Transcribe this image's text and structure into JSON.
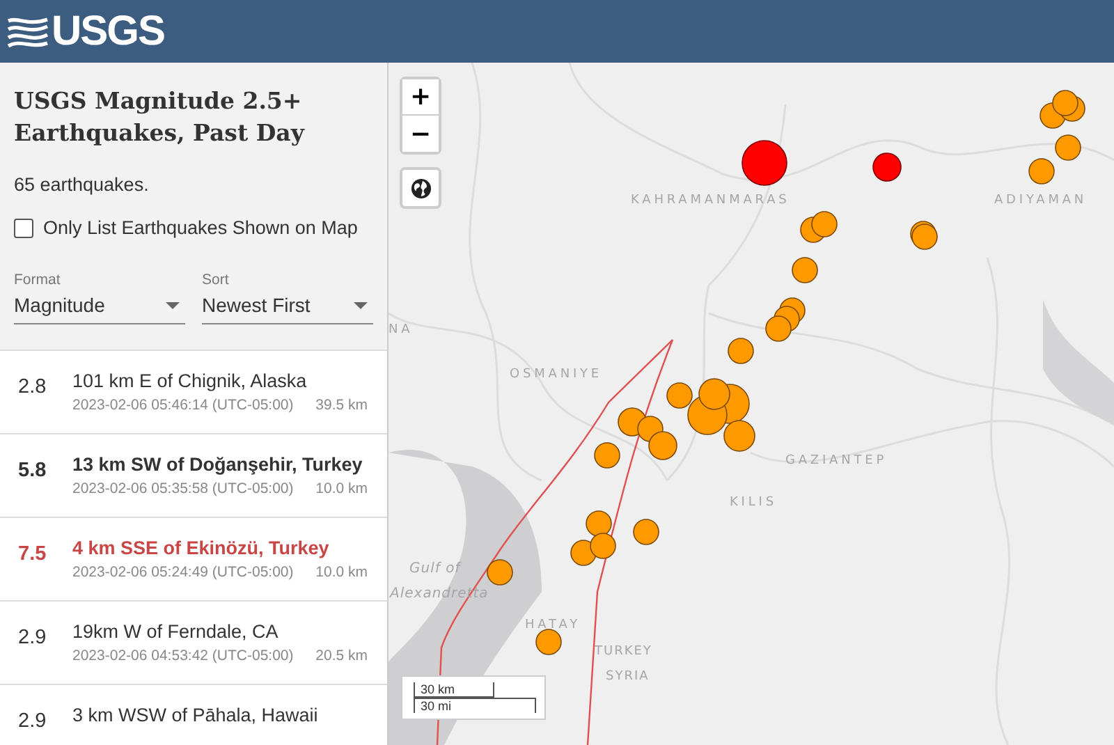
{
  "header": {
    "logo": "USGS"
  },
  "sidebar": {
    "title": "USGS Magnitude 2.5+ Earthquakes, Past Day",
    "count": "65 earthquakes.",
    "filter": {
      "label": "Only List Earthquakes Shown on Map",
      "checked": false
    },
    "selects": [
      {
        "label": "Format",
        "value": "Magnitude"
      },
      {
        "label": "Sort",
        "value": "Newest First"
      }
    ]
  },
  "earthquakes": [
    {
      "magnitude": "2.8",
      "place": "101 km E of Chignik, Alaska",
      "time": "2023-02-06 05:46:14 (UTC-05:00)",
      "depth": "39.5 km",
      "significant": false,
      "selected": false
    },
    {
      "magnitude": "5.8",
      "place": "13 km SW of Doğanşehir, Turkey",
      "time": "2023-02-06 05:35:58 (UTC-05:00)",
      "depth": "10.0 km",
      "significant": true,
      "selected": false
    },
    {
      "magnitude": "7.5",
      "place": "4 km SSE of Ekinözü, Turkey",
      "time": "2023-02-06 05:24:49 (UTC-05:00)",
      "depth": "10.0 km",
      "significant": true,
      "selected": true
    },
    {
      "magnitude": "2.9",
      "place": "19km W of Ferndale, CA",
      "time": "2023-02-06 04:53:42 (UTC-05:00)",
      "depth": "20.5 km",
      "significant": false,
      "selected": false
    },
    {
      "magnitude": "2.9",
      "place": "3 km WSW of Pāhala, Hawaii",
      "significant": false,
      "selected": false
    }
  ],
  "map": {
    "zoom_in": "+",
    "zoom_out": "−",
    "labels": [
      {
        "text": "KAHRAMANMARAS",
        "kind": "region"
      },
      {
        "text": "ADIYAMAN",
        "kind": "region"
      },
      {
        "text": "NA",
        "kind": "region"
      },
      {
        "text": "OSMANIYE",
        "kind": "region"
      },
      {
        "text": "GAZIANTEP",
        "kind": "region"
      },
      {
        "text": "KILIS",
        "kind": "region"
      },
      {
        "text": "Gulf of",
        "kind": "water"
      },
      {
        "text": "Alexandretta",
        "kind": "water"
      },
      {
        "text": "HATAY",
        "kind": "region"
      },
      {
        "text": "TURKEY",
        "kind": "country"
      },
      {
        "text": "SYRIA",
        "kind": "country"
      }
    ],
    "scale": [
      "30 km",
      "30 mi"
    ]
  }
}
